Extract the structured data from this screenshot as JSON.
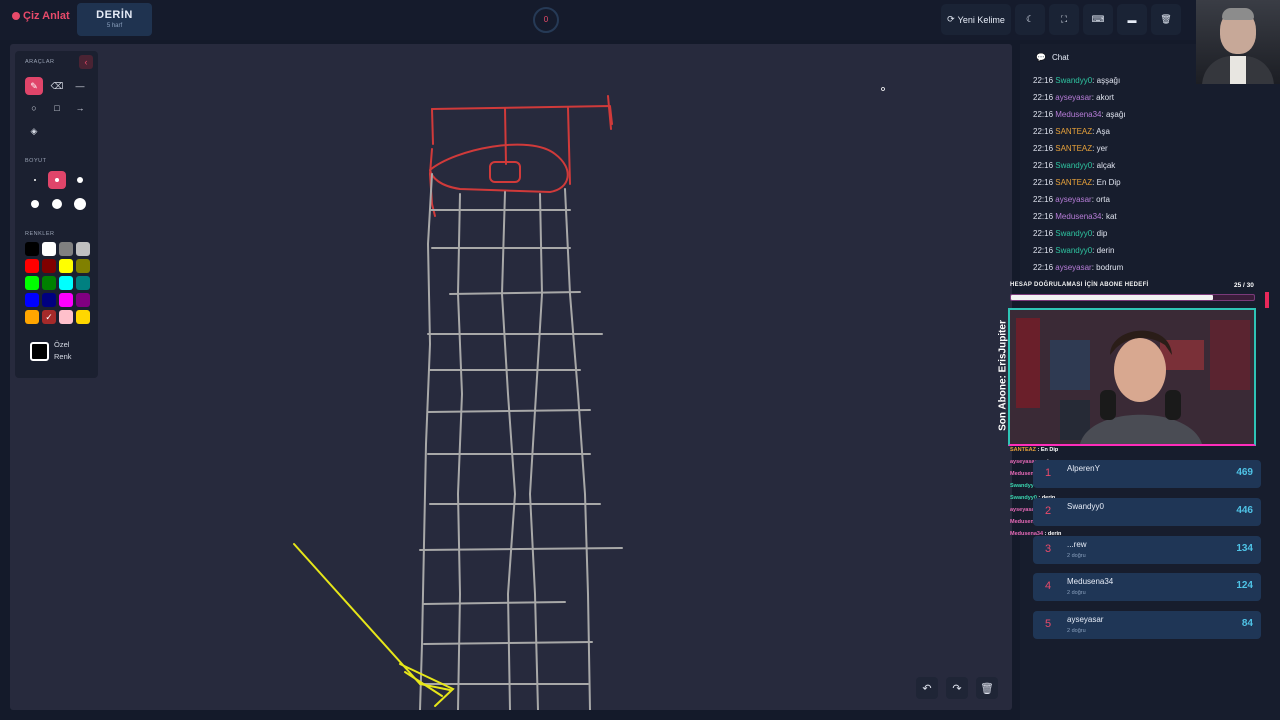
{
  "app": {
    "logo": "Çiz Anlat"
  },
  "word": {
    "text": "DERİN",
    "hint": "5 harf"
  },
  "timer": {
    "value": "0"
  },
  "toolbar": {
    "new_word": "Yeni Kelime"
  },
  "tools": {
    "section_tools": "ARAÇLAR",
    "section_size": "BOYUT",
    "section_colors": "RENKLER",
    "custom_color": "Özel Renk",
    "colors": [
      "#000000",
      "#ffffff",
      "#808080",
      "#c0c0c0",
      "#ff0000",
      "#800000",
      "#ffff00",
      "#808000",
      "#00ff00",
      "#008000",
      "#00ffff",
      "#008080",
      "#0000ff",
      "#000080",
      "#ff00ff",
      "#800080",
      "#ffa500",
      "#a52a2a",
      "#ffc0cb",
      "#ffd700"
    ]
  },
  "chat": {
    "title": "Chat",
    "messages": [
      {
        "time": "22:16",
        "user": "Swandyy0",
        "text": "aşşağı",
        "color": "#2ec4a0"
      },
      {
        "time": "22:16",
        "user": "ayseyasar",
        "text": "akort",
        "color": "#b77dd8"
      },
      {
        "time": "22:16",
        "user": "Medusena34",
        "text": "aşağı",
        "color": "#b77dd8"
      },
      {
        "time": "22:16",
        "user": "SANTEAZ",
        "text": "Aşa",
        "color": "#e8a23a"
      },
      {
        "time": "22:16",
        "user": "SANTEAZ",
        "text": "yer",
        "color": "#e8a23a"
      },
      {
        "time": "22:16",
        "user": "Swandyy0",
        "text": "alçak",
        "color": "#2ec4a0"
      },
      {
        "time": "22:16",
        "user": "SANTEAZ",
        "text": "En Dip",
        "color": "#e8a23a"
      },
      {
        "time": "22:16",
        "user": "ayseyasar",
        "text": "orta",
        "color": "#b77dd8"
      },
      {
        "time": "22:16",
        "user": "Medusena34",
        "text": "kat",
        "color": "#b77dd8"
      },
      {
        "time": "22:16",
        "user": "Swandyy0",
        "text": "dip",
        "color": "#2ec4a0"
      },
      {
        "time": "22:16",
        "user": "Swandyy0",
        "text": "derin",
        "color": "#2ec4a0"
      },
      {
        "time": "22:16",
        "user": "ayseyasar",
        "text": "bodrum",
        "color": "#b77dd8"
      }
    ]
  },
  "goal": {
    "label": "HESAP DOĞRULAMASI İÇİN ABONE HEDEFİ",
    "count": "25 / 30",
    "progress": 0.83
  },
  "stream": {
    "last_sub": "Son Abone: ErisJupiter"
  },
  "overlay_chat": [
    {
      "user": "SANTEAZ",
      "text": "En Dip",
      "color": "#e8a23a"
    },
    {
      "user": "ayseyasar",
      "text": "orta",
      "color": "#e86ab8"
    },
    {
      "user": "Medusena34",
      "text": "kat",
      "color": "#e86ab8"
    },
    {
      "user": "Swandyy0",
      "text": "dip",
      "color": "#3ad6b0"
    },
    {
      "user": "Swandyy0",
      "text": "derin",
      "color": "#3ad6b0"
    },
    {
      "user": "ayseyasar",
      "text": "bodrum",
      "color": "#e86ab8"
    },
    {
      "user": "Medusena34",
      "text": "derin",
      "color": "#e86ab8"
    },
    {
      "user": "Medusena34",
      "text": "derin",
      "color": "#e86ab8"
    }
  ],
  "leaderboard": [
    {
      "rank": "1",
      "name": "AlperenY",
      "sub": "",
      "score": "469"
    },
    {
      "rank": "2",
      "name": "Swandyy0",
      "sub": "",
      "score": "446"
    },
    {
      "rank": "3",
      "name": "...rew",
      "sub": "2 doğru",
      "score": "134"
    },
    {
      "rank": "4",
      "name": "Medusena34",
      "sub": "2 doğru",
      "score": "124"
    },
    {
      "rank": "5",
      "name": "ayseyasar",
      "sub": "2 doğru",
      "score": "84"
    }
  ]
}
